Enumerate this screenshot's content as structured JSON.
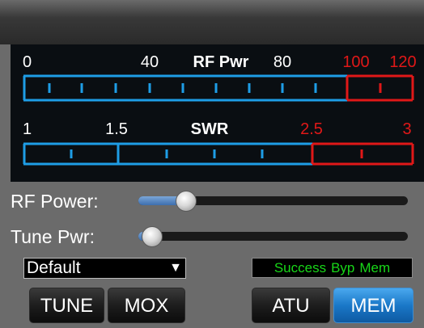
{
  "colors": {
    "scale_blue": "#1e9de6",
    "scale_red": "#e01818",
    "status_green": "#18d818",
    "active_button": "#1a78c8"
  },
  "rf_meter": {
    "title": "RF Pwr",
    "labels": [
      "0",
      "40",
      "80",
      "100",
      "120"
    ]
  },
  "swr_meter": {
    "title": "SWR",
    "labels": [
      "1",
      "1.5",
      "2.5",
      "3"
    ]
  },
  "rf_power": {
    "label": "RF Power:",
    "level": 0.14
  },
  "tune_pwr": {
    "label": "Tune Pwr:",
    "level": 0.0
  },
  "profile": {
    "selected": "Default"
  },
  "status": {
    "items": [
      "Success",
      "Byp",
      "Mem"
    ]
  },
  "buttons": {
    "tune": "TUNE",
    "mox": "MOX",
    "atu": "ATU",
    "mem": "MEM"
  }
}
